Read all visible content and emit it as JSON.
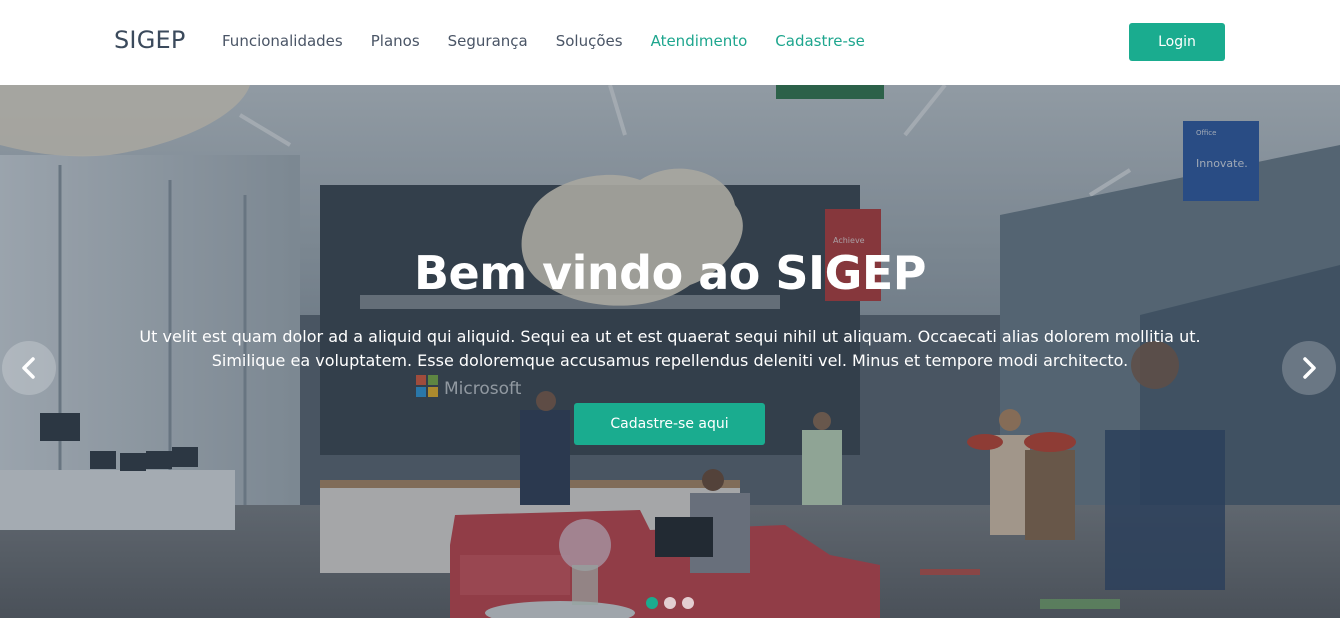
{
  "header": {
    "brand": "SIGEP",
    "nav": [
      {
        "label": "Funcionalidades",
        "accent": false
      },
      {
        "label": "Planos",
        "accent": false
      },
      {
        "label": "Segurança",
        "accent": false
      },
      {
        "label": "Soluções",
        "accent": false
      },
      {
        "label": "Atendimento",
        "accent": true
      },
      {
        "label": "Cadastre-se",
        "accent": true
      }
    ],
    "login_label": "Login"
  },
  "hero": {
    "title": "Bem vindo ao SIGEP",
    "text": "Ut velit est quam dolor ad a aliquid qui aliquid. Sequi ea ut et est quaerat sequi nihil ut aliquam. Occaecati alias dolorem mollitia ut. Similique ea voluptatem. Esse doloremque accusamus repellendus deleniti vel. Minus et tempore modi architecto.",
    "cta_label": "Cadastre-se aqui",
    "background_signage": {
      "logo_text": "Microsoft",
      "banner_text": "Innovate.",
      "banner_small": "Office",
      "red_banner_text": "Achieve"
    },
    "prev_icon": "chevron-left-icon",
    "next_icon": "chevron-right-icon",
    "slides": [
      {
        "active": true
      },
      {
        "active": false
      },
      {
        "active": false
      }
    ]
  },
  "colors": {
    "accent": "#1aac8f",
    "nav_text": "#4a5566",
    "brand_text": "#3b4a5c"
  }
}
